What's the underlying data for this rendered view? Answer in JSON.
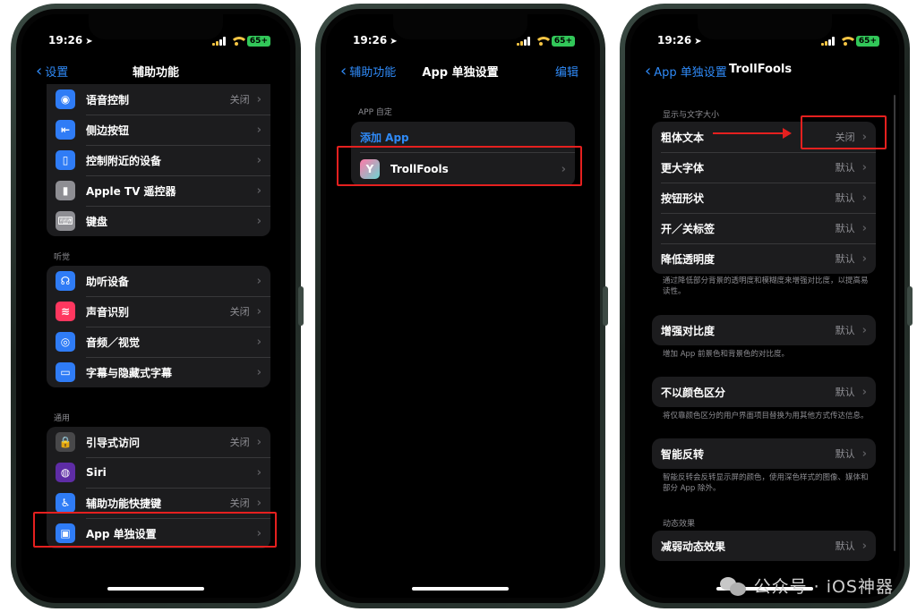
{
  "status": {
    "time": "19:26",
    "battery": "65+"
  },
  "screen1": {
    "back_label": "设置",
    "title": "辅助功能",
    "group_top": [
      {
        "label": "语音控制",
        "value": "关闭",
        "icon": "voice-control-icon",
        "color": "#2f7cf6",
        "glyph": "◉"
      },
      {
        "label": "侧边按钮",
        "value": "",
        "icon": "side-button-icon",
        "color": "#2f7cf6",
        "glyph": "⇤"
      },
      {
        "label": "控制附近的设备",
        "value": "",
        "icon": "nearby-devices-icon",
        "color": "#2f7cf6",
        "glyph": "▯"
      },
      {
        "label": "Apple TV 遥控器",
        "value": "",
        "icon": "tv-remote-icon",
        "color": "#8e8e93",
        "glyph": "▮"
      },
      {
        "label": "键盘",
        "value": "",
        "icon": "keyboard-icon",
        "color": "#8e8e93",
        "glyph": "⌨"
      }
    ],
    "hearing_header": "听觉",
    "group_hearing": [
      {
        "label": "助听设备",
        "value": "",
        "icon": "hearing-device-icon",
        "color": "#2f7cf6",
        "glyph": "☊"
      },
      {
        "label": "声音识别",
        "value": "关闭",
        "icon": "sound-recognition-icon",
        "color": "#ff375f",
        "glyph": "≋"
      },
      {
        "label": "音频／视觉",
        "value": "",
        "icon": "audio-visual-icon",
        "color": "#2f7cf6",
        "glyph": "◎"
      },
      {
        "label": "字幕与隐藏式字幕",
        "value": "",
        "icon": "subtitles-icon",
        "color": "#2f7cf6",
        "glyph": "▭"
      }
    ],
    "general_header": "通用",
    "group_general": [
      {
        "label": "引导式访问",
        "value": "关闭",
        "icon": "guided-access-icon",
        "color": "#48484a",
        "glyph": "🔒"
      },
      {
        "label": "Siri",
        "value": "",
        "icon": "siri-icon",
        "color": "#5e2ca5",
        "glyph": "◍"
      },
      {
        "label": "辅助功能快捷键",
        "value": "关闭",
        "icon": "accessibility-shortcut-icon",
        "color": "#2f7cf6",
        "glyph": "♿"
      },
      {
        "label": "App 单独设置",
        "value": "",
        "icon": "per-app-settings-icon",
        "color": "#2f7cf6",
        "glyph": "▣"
      }
    ]
  },
  "screen2": {
    "back_label": "辅助功能",
    "title": "App 单独设置",
    "edit_label": "编辑",
    "section_header": "APP 自定",
    "add_app_label": "添加 App",
    "app_name": "TrollFools"
  },
  "screen3": {
    "back_label": "App 单独设置",
    "title": "TrollFools",
    "display_header": "显示与文字大小",
    "display_rows": [
      {
        "label": "粗体文本",
        "value": "关闭"
      },
      {
        "label": "更大字体",
        "value": "默认"
      },
      {
        "label": "按钮形状",
        "value": "默认"
      },
      {
        "label": "开／关标签",
        "value": "默认"
      },
      {
        "label": "降低透明度",
        "value": "默认"
      }
    ],
    "transparency_footer": "通过降低部分背景的透明度和模糊度来增强对比度，以提高易读性。",
    "contrast_label": "增强对比度",
    "contrast_value": "默认",
    "contrast_footer": "增加 App 前景色和背景色的对比度。",
    "color_label": "不以颜色区分",
    "color_value": "默认",
    "color_footer": "将仅靠颜色区分的用户界面项目替换为用其他方式传达信息。",
    "invert_label": "智能反转",
    "invert_value": "默认",
    "invert_footer": "智能反转会反转显示屏的颜色，使用深色样式的图像、媒体和部分 App 除外。",
    "motion_header": "动态效果",
    "motion_label": "减弱动态效果",
    "motion_value": "默认"
  },
  "watermark": {
    "text": "公众号 · iOS神器"
  }
}
